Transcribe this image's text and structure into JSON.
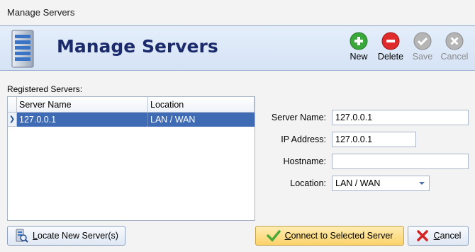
{
  "window": {
    "title": "Manage Servers"
  },
  "banner": {
    "title": "Manage Servers"
  },
  "toolbar": {
    "new_label": "New",
    "delete_label": "Delete",
    "save_label": "Save",
    "cancel_label": "Cancel"
  },
  "servers": {
    "label": "Registered Servers:",
    "columns": [
      "Server Name",
      "Location"
    ],
    "rows": [
      {
        "server_name": "127.0.0.1",
        "location": "LAN / WAN",
        "selected": true
      }
    ]
  },
  "form": {
    "server_name_label": "Server Name:",
    "server_name_value": "127.0.0.1",
    "ip_address_label": "IP Address:",
    "ip_address_value": "127.0.0.1",
    "hostname_label": "Hostname:",
    "hostname_value": "",
    "location_label": "Location:",
    "location_value": "LAN / WAN"
  },
  "buttons": {
    "locate_first": "L",
    "locate_rest": "ocate New Server(s)",
    "connect_first": "C",
    "connect_rest": "onnect to Selected Server",
    "cancel_first": "C",
    "cancel_rest": "ancel"
  },
  "colors": {
    "selection": "#3f6bb5",
    "banner_title": "#1b2a6b",
    "primary_button": "#fbd26a"
  }
}
